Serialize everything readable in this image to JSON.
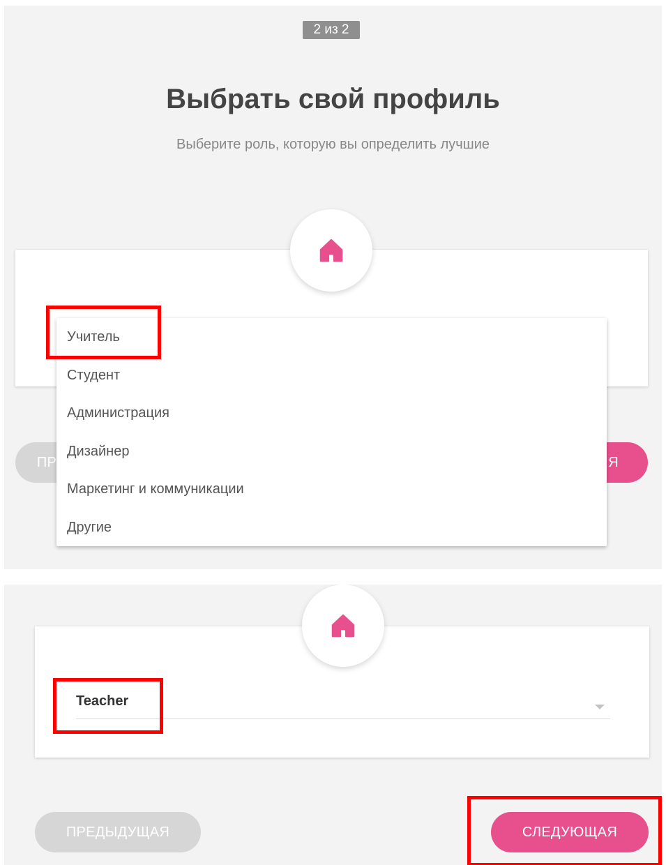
{
  "step": {
    "label": "2 из 2"
  },
  "header": {
    "title": "Выбрать свой профиль",
    "subtitle": "Выберите роль, которую вы определить лучшие"
  },
  "icon": {
    "name": "home-icon",
    "color": "#e7508c"
  },
  "role_dropdown": {
    "options": [
      "Учитель",
      "Студент",
      "Администрация",
      "Дизайнер",
      "Маркетинг и коммуникации",
      "Другие"
    ]
  },
  "role_select": {
    "value": "Teacher"
  },
  "buttons": {
    "prev_label": "ПРЕДЫДУЩАЯ",
    "prev_partial_label": "ПР",
    "next_label": "СЛЕДУЮЩАЯ",
    "next_partial_label": "Я"
  },
  "colors": {
    "accent": "#e7508c",
    "disabled": "#d6d6d6",
    "highlight": "#ff0000",
    "panel": "#f3f3f3"
  }
}
